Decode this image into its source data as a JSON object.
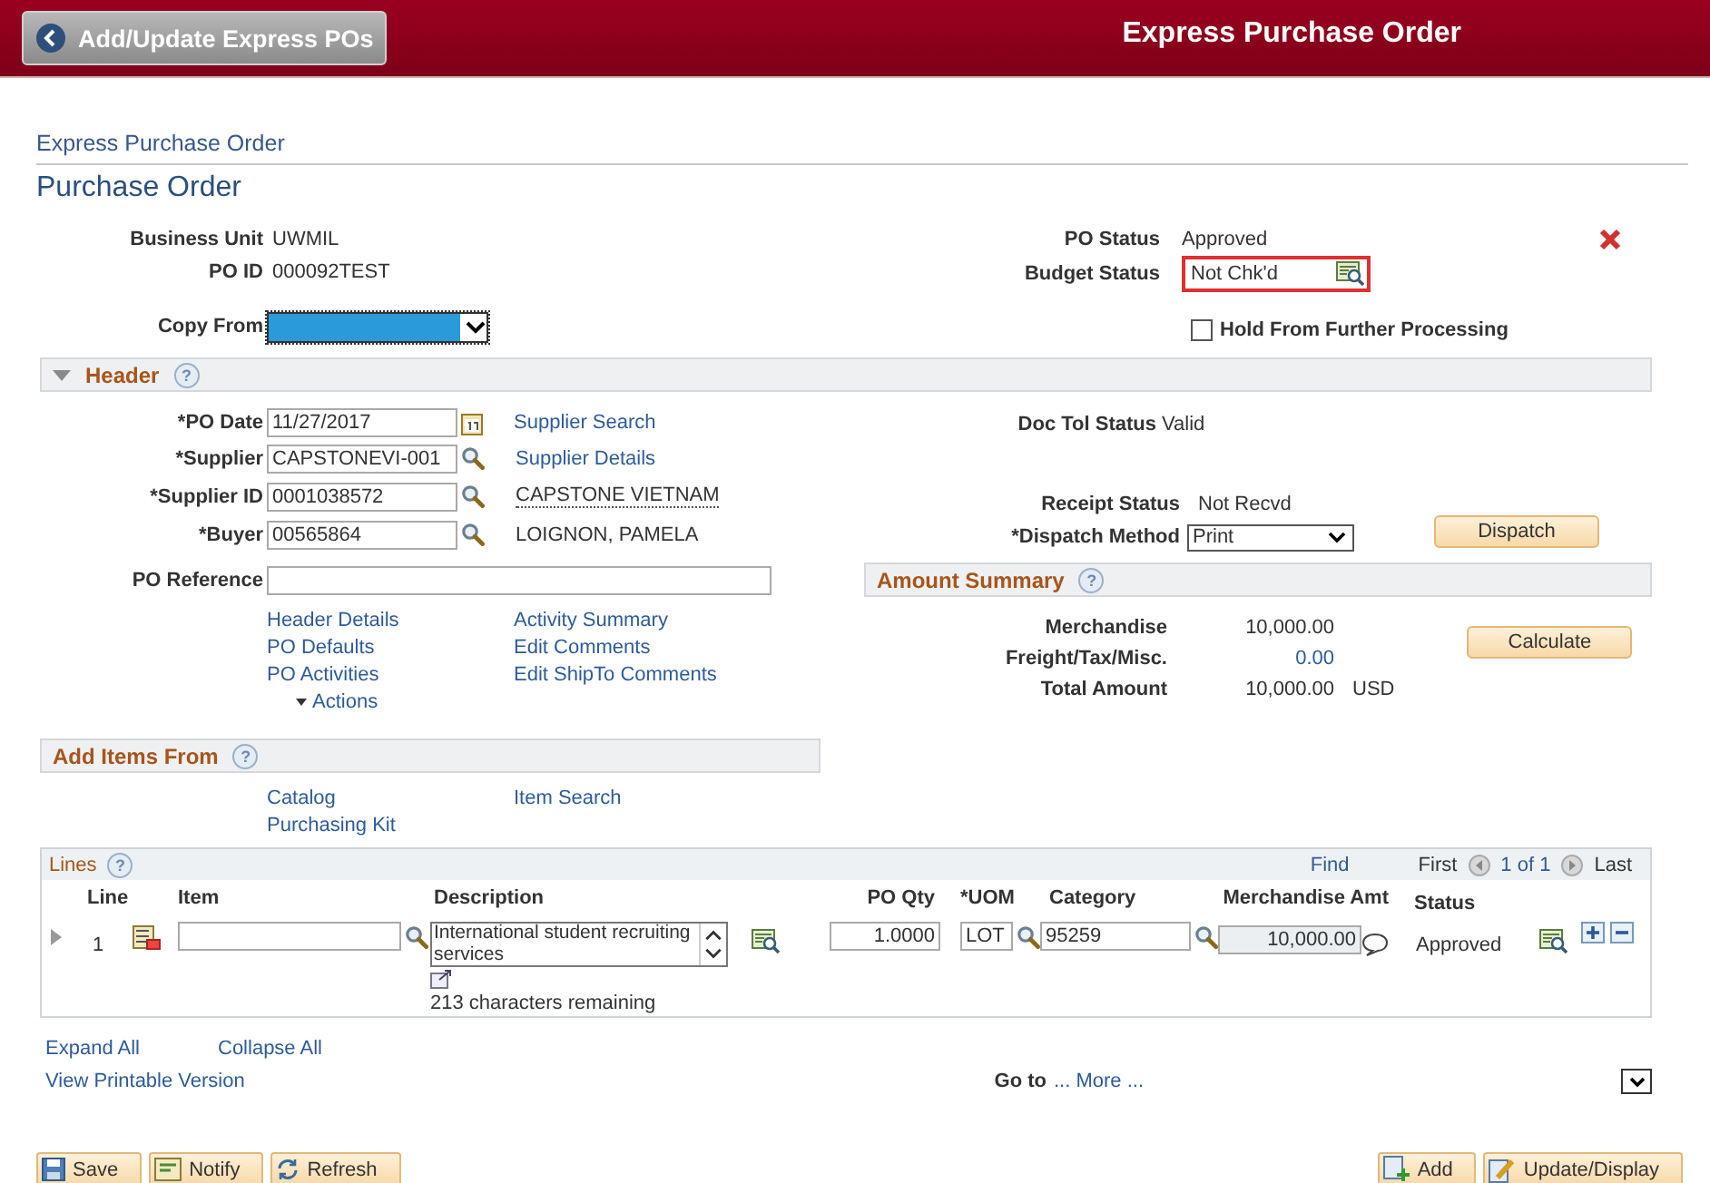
{
  "nav": {
    "back_button": "Add/Update Express POs",
    "title": "Express Purchase Order"
  },
  "breadcrumb": "Express Purchase Order",
  "page_title": "Purchase Order",
  "identity": [
    {
      "label": "Business Unit",
      "value": "UWMIL"
    },
    {
      "label": "PO ID",
      "value": "000092TEST"
    }
  ],
  "status": [
    {
      "label": "PO Status",
      "value": "Approved",
      "highlighted": false,
      "kind": "text"
    },
    {
      "label": "Budget Status",
      "value": "Not Chk'd",
      "highlighted": true,
      "kind": "inspect"
    }
  ],
  "copy_from": {
    "label": "Copy From"
  },
  "hold": {
    "label": "Hold From Further Processing",
    "checked": false
  },
  "header": {
    "title": "Header",
    "help": "?",
    "fields": [
      {
        "label": "*PO Date",
        "value": "11/27/2017",
        "kind": "calendar",
        "aside": {
          "text": "Supplier Search",
          "kind": "link"
        }
      },
      {
        "label": "*Supplier",
        "value": "CAPSTONEVI-001",
        "kind": "lookup",
        "aside": {
          "text": "Supplier Details",
          "kind": "link"
        }
      },
      {
        "label": "*Supplier ID",
        "value": "0001038572",
        "kind": "lookup",
        "aside": {
          "text": "CAPSTONE VIETNAM",
          "kind": "tip"
        }
      },
      {
        "label": "*Buyer",
        "value": "00565864",
        "kind": "lookup",
        "aside": {
          "text": "LOIGNON, PAMELA",
          "kind": "text"
        }
      },
      {
        "label": "PO Reference",
        "kind": "wide"
      }
    ],
    "links": [
      [
        "Header Details",
        "PO Defaults",
        "PO Activities"
      ],
      [
        "Activity Summary",
        "Edit Comments",
        "Edit ShipTo Comments"
      ]
    ],
    "actions": "Actions",
    "doc_tol": {
      "label": "Doc Tol Status",
      "value": "Valid"
    },
    "receipt": {
      "label": "Receipt Status",
      "value": "Not Recvd"
    },
    "dispatch_method": {
      "label": "*Dispatch Method",
      "value": "Print"
    },
    "dispatch_button": "Dispatch"
  },
  "amount_summary": {
    "title": "Amount Summary",
    "help": "?",
    "rows": [
      {
        "label": "Merchandise",
        "value": "10,000.00",
        "kind": "text"
      },
      {
        "label": "Freight/Tax/Misc.",
        "value": "0.00",
        "kind": "link"
      },
      {
        "label": "Total Amount",
        "value": "10,000.00",
        "currency": "USD",
        "kind": "text"
      }
    ],
    "button": "Calculate"
  },
  "add_items": {
    "title": "Add Items From",
    "help": "?",
    "links": [
      [
        "Catalog",
        "Purchasing Kit"
      ],
      [
        "Item Search"
      ]
    ]
  },
  "lines": {
    "title": "Lines",
    "help": "?",
    "find": "Find",
    "first": "First",
    "count": "1 of 1",
    "last": "Last",
    "columns": [
      "Line",
      "Item",
      "Description",
      "PO Qty",
      "*UOM",
      "Category",
      "Merchandise Amt",
      "Status"
    ],
    "rows": [
      {
        "line": "1",
        "expanded": false,
        "description": "International student recruiting services",
        "remaining": "213 characters remaining",
        "po_qty": "1.0000",
        "uom": "LOT",
        "category": "95259",
        "merchandise_amt": "10,000.00",
        "status": "Approved"
      }
    ]
  },
  "footer": {
    "expand_all": "Expand All",
    "collapse_all": "Collapse All",
    "printable": "View Printable Version",
    "goto_label": "Go to",
    "goto_link": "... More ..."
  },
  "buttons_left": [
    {
      "label": "Save",
      "kind": "save"
    },
    {
      "label": "Notify",
      "kind": "notify"
    },
    {
      "label": "Refresh",
      "kind": "refresh"
    }
  ],
  "buttons_right": [
    {
      "label": "Add",
      "kind": "add"
    },
    {
      "label": "Update/Display",
      "kind": "update"
    }
  ]
}
